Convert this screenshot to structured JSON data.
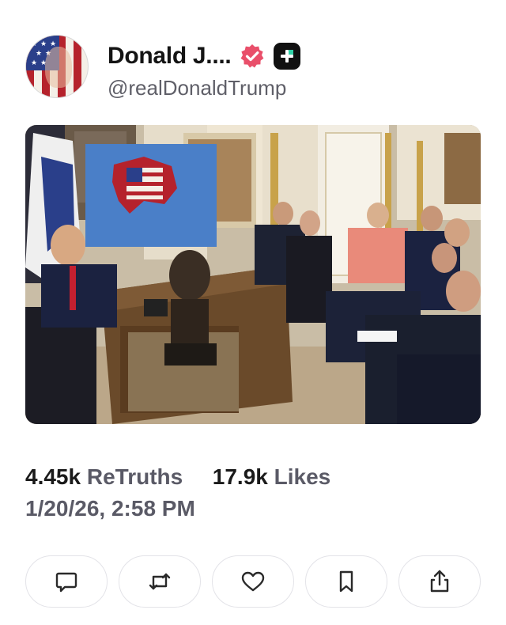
{
  "post": {
    "author": {
      "display_name": "Donald J....",
      "handle": "@realDonaldTrump",
      "verified_badge_icon": "verified-badge-icon",
      "plus_badge_icon": "plus-badge-icon"
    },
    "media": {
      "kind": "photo",
      "content": "Meeting in an ornate oval office: a man seated behind a wooden desk at left, a framed map of North America in US flag colors on an easel, several people seated on sofas and chairs at right."
    },
    "stats": {
      "retruths_count": "4.45k",
      "retruths_label": "ReTruths",
      "likes_count": "17.9k",
      "likes_label": "Likes"
    },
    "timestamp": "1/20/26, 2:58 PM"
  },
  "actions": [
    {
      "name": "reply-button",
      "icon": "speech-bubble-icon"
    },
    {
      "name": "retruth-button",
      "icon": "repost-arrows-icon"
    },
    {
      "name": "like-button",
      "icon": "heart-icon"
    },
    {
      "name": "bookmark-button",
      "icon": "bookmark-icon"
    },
    {
      "name": "share-button",
      "icon": "share-upload-icon"
    }
  ],
  "colors": {
    "verified_badge": "#e94f6a",
    "secondary_text": "#5a5a66",
    "button_border": "#e3e3e8"
  }
}
